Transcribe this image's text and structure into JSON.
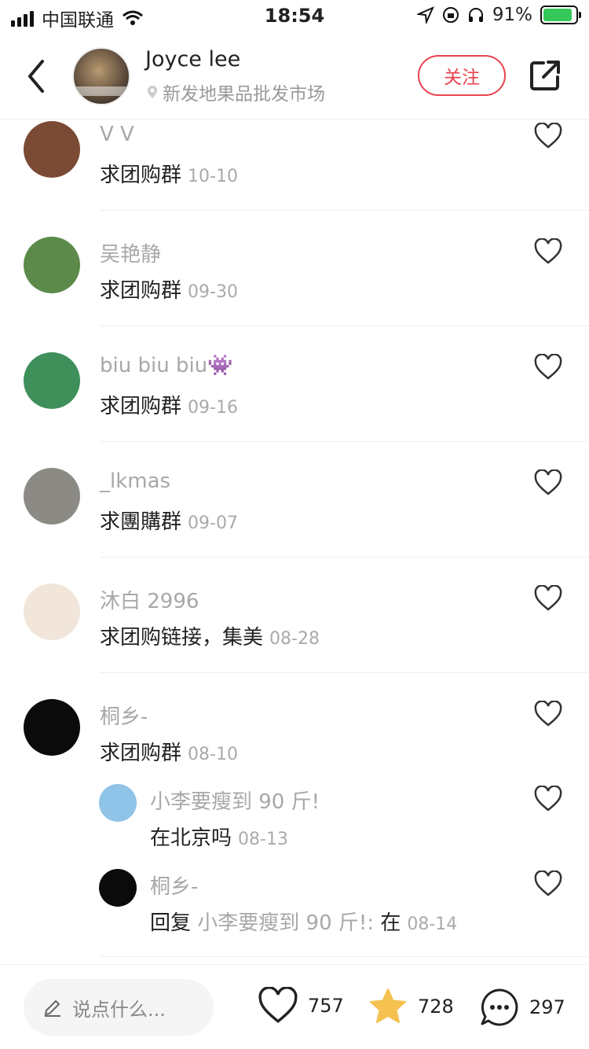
{
  "status_bar": {
    "carrier": "中国联通",
    "time": "18:54",
    "battery": "91%",
    "battery_level": 0.91
  },
  "header": {
    "author_name": "Joyce lee",
    "location": "新发地果品批发市场",
    "follow_label": "关注"
  },
  "comments": [
    {
      "name": "V V",
      "text": "求团购群",
      "date": "10-10",
      "avatar_color": "#7a4a34"
    },
    {
      "name": "吴艳静",
      "text": "求团购群",
      "date": "09-30",
      "avatar_color": "#5c8a4a"
    },
    {
      "name": "biu biu biu👾",
      "text": "求团购群",
      "date": "09-16",
      "avatar_color": "#3f8f5a"
    },
    {
      "name": "_lkmas",
      "text": "求團購群",
      "date": "09-07",
      "avatar_color": "#8c8a85"
    },
    {
      "name": "沐白 2996",
      "text": "求团购链接，集美",
      "date": "08-28",
      "avatar_color": "#f2e6da"
    },
    {
      "name": "桐乡-",
      "text": "求团购群",
      "date": "08-10",
      "avatar_color": "#0b0b0b"
    }
  ],
  "replies": [
    {
      "name": "小李要瘦到 90 斤!",
      "text": "在北京吗",
      "date": "08-13",
      "avatar_color": "#8fc3e8"
    },
    {
      "name": "桐乡-",
      "prefix": "回复",
      "reply_to": "小李要瘦到 90 斤!:",
      "text": "在",
      "date": "08-14",
      "avatar_color": "#0b0b0b"
    }
  ],
  "bottom_bar": {
    "input_placeholder": "说点什么...",
    "likes": "757",
    "favorites": "728",
    "comments": "297"
  },
  "colors": {
    "accent": "#e8434f",
    "star": "#f5c150",
    "muted": "#a8a8a8"
  },
  "icons": [
    "back-icon",
    "location-pin-icon",
    "share-icon",
    "heart-icon",
    "pencil-icon",
    "star-icon",
    "chat-icon",
    "signal-icon",
    "wifi-icon",
    "battery-icon"
  ]
}
